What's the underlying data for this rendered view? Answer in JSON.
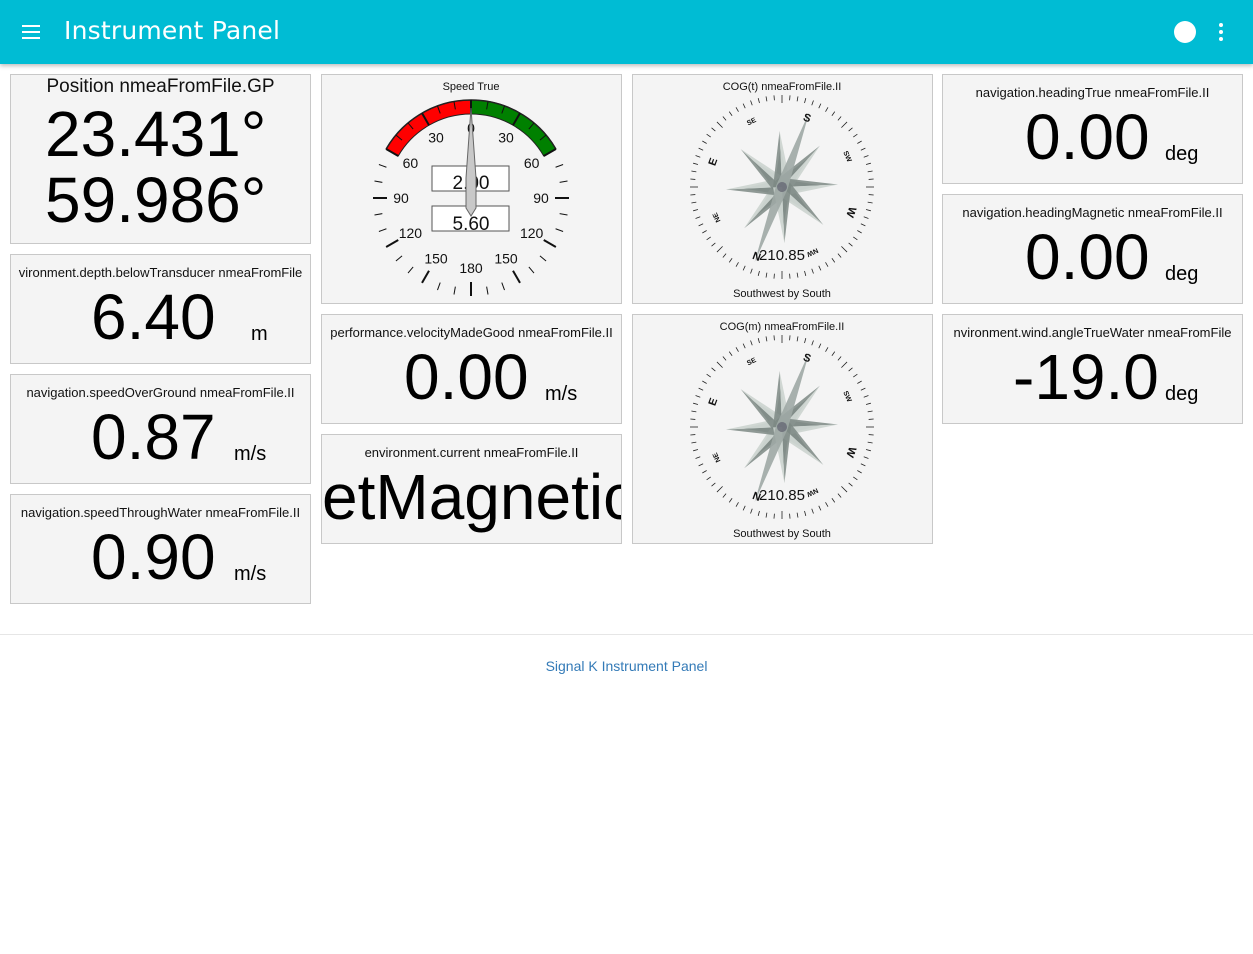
{
  "appbar": {
    "title": "Instrument Panel",
    "menu_icon": "hamburger-menu-icon",
    "status_icon": "connection-status-icon",
    "more_icon": "more-vertical-icon"
  },
  "colors": {
    "accent": "#00bcd4",
    "tile_bg": "#f4f4f4",
    "link": "#337ab7",
    "gauge_red": "#ff0000",
    "gauge_green": "#008000"
  },
  "position": {
    "label": "Position nmeaFromFile.GP",
    "latitude": "23.431°",
    "longitude": "59.986°"
  },
  "depth": {
    "label": "vironment.depth.belowTransducer nmeaFromFile",
    "value": "6.40",
    "unit": "m"
  },
  "sog": {
    "label": "navigation.speedOverGround nmeaFromFile.II",
    "value": "0.87",
    "unit": "m/s"
  },
  "stw": {
    "label": "navigation.speedThroughWater nmeaFromFile.II",
    "value": "0.90",
    "unit": "m/s"
  },
  "speed_gauge": {
    "title": "Speed True",
    "value_top": "2.00",
    "value_bottom": "5.60",
    "scale_labels": [
      "0",
      "30",
      "60",
      "90",
      "120",
      "150",
      "180",
      "150",
      "120",
      "90",
      "60",
      "30"
    ],
    "pointer_angle_deg": 0
  },
  "vmg": {
    "label": "performance.velocityMadeGood nmeaFromFile.II",
    "value": "0.00",
    "unit": "m/s"
  },
  "current": {
    "label": "environment.current nmeaFromFile.II",
    "value": "setMagnetic"
  },
  "cog_true": {
    "title": "COG(t) nmeaFromFile.II",
    "value": "210.85",
    "description": "Southwest by South",
    "cardinals": [
      "S",
      "SW",
      "W",
      "NW",
      "N",
      "NE",
      "E",
      "SE"
    ]
  },
  "cog_mag": {
    "title": "COG(m) nmeaFromFile.II",
    "value": "210.85",
    "description": "Southwest by South",
    "cardinals": [
      "S",
      "SW",
      "W",
      "NW",
      "N",
      "NE",
      "E",
      "SE"
    ]
  },
  "heading_true": {
    "label": "navigation.headingTrue nmeaFromFile.II",
    "value": "0.00",
    "unit": "deg"
  },
  "heading_mag": {
    "label": "navigation.headingMagnetic nmeaFromFile.II",
    "value": "0.00",
    "unit": "deg"
  },
  "wind_angle": {
    "label": "nvironment.wind.angleTrueWater nmeaFromFile",
    "value": "-19.0",
    "unit": "deg"
  },
  "footer": {
    "link": "Signal K Instrument Panel"
  }
}
